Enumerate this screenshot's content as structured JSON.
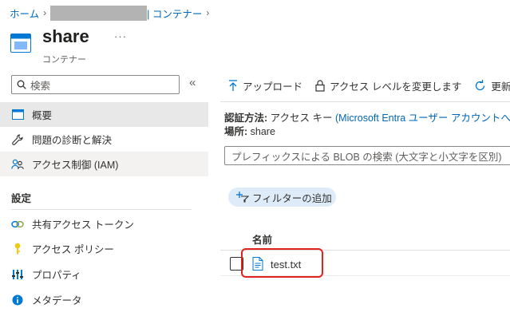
{
  "breadcrumb": {
    "home": "ホーム",
    "containers": "| コンテナー"
  },
  "header": {
    "title": "share",
    "more": "···",
    "subtitle": "コンテナー"
  },
  "search": {
    "placeholder": "検索",
    "collapse": "«"
  },
  "sidebar": {
    "items": [
      {
        "label": "概要",
        "icon": "overview-icon"
      },
      {
        "label": "問題の診断と解決",
        "icon": "wrench-icon"
      },
      {
        "label": "アクセス制御 (IAM)",
        "icon": "people-icon"
      }
    ],
    "section_title": "設定",
    "settings_items": [
      {
        "label": "共有アクセス トークン",
        "icon": "link-icon"
      },
      {
        "label": "アクセス ポリシー",
        "icon": "key-icon"
      },
      {
        "label": "プロパティ",
        "icon": "properties-icon"
      },
      {
        "label": "メタデータ",
        "icon": "info-icon"
      }
    ]
  },
  "toolbar": {
    "upload": "アップロード",
    "change_access": "アクセス レベルを変更します",
    "refresh": "更新"
  },
  "info": {
    "auth_label": "認証方法:",
    "auth_value": "アクセス キー",
    "auth_link": "(Microsoft Entra ユーザー アカウントへの切",
    "location_label": "場所:",
    "location_value": "share"
  },
  "blob_search": {
    "placeholder": "プレフィックスによる BLOB の検索 (大文字と小文字を区別)"
  },
  "filter": {
    "label": "フィルターの追加"
  },
  "table": {
    "column_name": "名前",
    "rows": [
      {
        "name": "test.txt"
      }
    ]
  },
  "colors": {
    "accent": "#0067b8",
    "highlight": "#e0231e",
    "selected_bg": "#e8e8e8",
    "pill_bg": "#deecf9"
  }
}
